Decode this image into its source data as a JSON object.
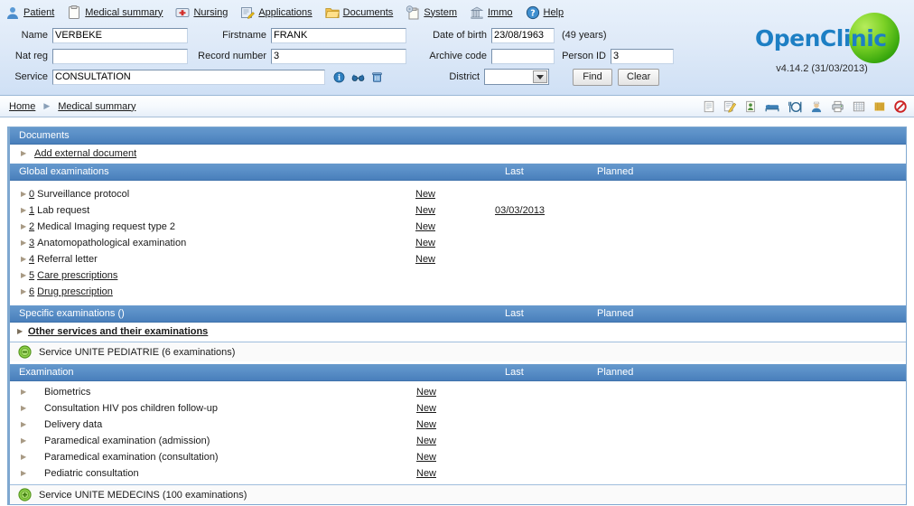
{
  "nav": {
    "items": [
      {
        "label": "Patient",
        "icon": "user-icon"
      },
      {
        "label": "Medical summary",
        "icon": "clipboard-icon"
      },
      {
        "label": "Nursing",
        "icon": "firstaid-icon"
      },
      {
        "label": "Applications",
        "icon": "applications-icon"
      },
      {
        "label": "Documents",
        "icon": "folder-icon"
      },
      {
        "label": "System",
        "icon": "system-icon"
      },
      {
        "label": "Immo",
        "icon": "building-icon"
      },
      {
        "label": "Help",
        "icon": "help-icon"
      }
    ]
  },
  "patient_form": {
    "name_label": "Name",
    "name_value": "VERBEKE",
    "firstname_label": "Firstname",
    "firstname_value": "FRANK",
    "dob_label": "Date of birth",
    "dob_value": "23/08/1963",
    "age_note": "(49 years)",
    "natreg_label": "Nat reg",
    "natreg_value": "",
    "record_label": "Record number",
    "record_value": "3",
    "archive_label": "Archive code",
    "archive_value": "",
    "personid_label": "Person ID",
    "personid_value": "3",
    "service_label": "Service",
    "service_value": "CONSULTATION",
    "district_label": "District",
    "district_value": "",
    "find_label": "Find",
    "clear_label": "Clear",
    "service_icons": [
      "info-icon",
      "glasses-icon",
      "trash-icon"
    ]
  },
  "logo": {
    "brand_open": "Open",
    "brand_clinic": "Clinic",
    "version": "v4.14.2 (31/03/2013)"
  },
  "breadcrumb": {
    "home": "Home",
    "separator": "▶",
    "current": "Medical summary",
    "icons": [
      "document-icon",
      "edit-note-icon",
      "id-card-icon",
      "bed-icon",
      "meal-icon",
      "nurse-icon",
      "printer-icon",
      "grid-icon",
      "barcode-icon",
      "forbidden-icon"
    ]
  },
  "documents": {
    "title": "Documents",
    "add_external": "Add external document",
    "global": {
      "title": "Global examinations",
      "col_last": "Last",
      "col_planned": "Planned",
      "rows": [
        {
          "num": "0",
          "label": "Surveillance protocol",
          "label_is_link": false,
          "new": "New",
          "last": "",
          "planned": ""
        },
        {
          "num": "1",
          "label": "Lab request",
          "label_is_link": false,
          "new": "New",
          "last": "03/03/2013",
          "planned": ""
        },
        {
          "num": "2",
          "label": "Medical Imaging request type 2",
          "label_is_link": false,
          "new": "New",
          "last": "",
          "planned": ""
        },
        {
          "num": "3",
          "label": "Anatomopathological examination",
          "label_is_link": false,
          "new": "New",
          "last": "",
          "planned": ""
        },
        {
          "num": "4",
          "label": "Referral letter",
          "label_is_link": false,
          "new": "New",
          "last": "",
          "planned": ""
        },
        {
          "num": "5",
          "label": "Care prescriptions",
          "label_is_link": true,
          "new": "",
          "last": "",
          "planned": ""
        },
        {
          "num": "6",
          "label": "Drug prescription",
          "label_is_link": true,
          "new": "",
          "last": "",
          "planned": ""
        }
      ]
    },
    "specific": {
      "title": "Specific examinations ()",
      "col_last": "Last",
      "col_planned": "Planned",
      "other_services": "Other services and their examinations"
    },
    "service_pediatrie": {
      "icon": "minus-circle-icon",
      "label": "Service UNITE PEDIATRIE (6 examinations)"
    },
    "exam_table": {
      "title": "Examination",
      "col_last": "Last",
      "col_planned": "Planned",
      "rows": [
        {
          "label": "Biometrics",
          "new": "New",
          "last": "",
          "planned": ""
        },
        {
          "label": "Consultation HIV pos children follow-up",
          "new": "New",
          "last": "",
          "planned": ""
        },
        {
          "label": "Delivery data",
          "new": "New",
          "last": "",
          "planned": ""
        },
        {
          "label": "Paramedical examination (admission)",
          "new": "New",
          "last": "",
          "planned": ""
        },
        {
          "label": "Paramedical examination (consultation)",
          "new": "New",
          "last": "",
          "planned": ""
        },
        {
          "label": "Pediatric consultation",
          "new": "New",
          "last": "",
          "planned": ""
        }
      ]
    },
    "service_medecins": {
      "icon": "plus-circle-icon",
      "label": "Service UNITE MEDECINS  (100 examinations)"
    }
  },
  "colors": {
    "header_blue": "#5b90c8",
    "link_blue": "#1d7fc4",
    "logo_green": "#7dd227",
    "panel_border": "#7fa8d0"
  }
}
